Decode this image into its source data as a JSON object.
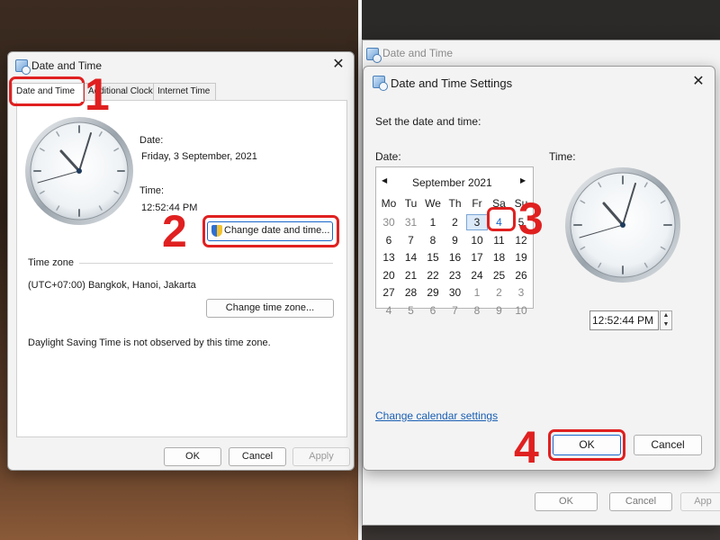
{
  "left_dialog": {
    "title": "Date and Time",
    "tabs": [
      "Date and Time",
      "Additional Clocks",
      "Internet Time"
    ],
    "date_label": "Date:",
    "date_value": "Friday, 3 September, 2021",
    "time_label": "Time:",
    "time_value": "12:52:44 PM",
    "change_datetime_button": "Change date and time...",
    "timezone_heading": "Time zone",
    "timezone_value": "(UTC+07:00) Bangkok, Hanoi, Jakarta",
    "change_timezone_button": "Change time zone...",
    "dst_note": "Daylight Saving Time is not observed by this time zone.",
    "ok": "OK",
    "cancel": "Cancel",
    "apply": "Apply"
  },
  "background_dialog": {
    "title": "Date and Time",
    "ok": "OK",
    "cancel": "Cancel",
    "apply": "App"
  },
  "settings_dialog": {
    "title": "Date and Time Settings",
    "instruction": "Set the date and time:",
    "date_label": "Date:",
    "time_label": "Time:",
    "calendar": {
      "month": "September 2021",
      "prev": "◀",
      "next": "▶",
      "weekdays": [
        "Mo",
        "Tu",
        "We",
        "Th",
        "Fr",
        "Sa",
        "Su"
      ],
      "weeks": [
        [
          "30",
          "31",
          "1",
          "2",
          "3",
          "4",
          "5"
        ],
        [
          "6",
          "7",
          "8",
          "9",
          "10",
          "11",
          "12"
        ],
        [
          "13",
          "14",
          "15",
          "16",
          "17",
          "18",
          "19"
        ],
        [
          "20",
          "21",
          "22",
          "23",
          "24",
          "25",
          "26"
        ],
        [
          "27",
          "28",
          "29",
          "30",
          "1",
          "2",
          "3"
        ],
        [
          "4",
          "5",
          "6",
          "7",
          "8",
          "9",
          "10"
        ]
      ],
      "today": "3",
      "selected": "4"
    },
    "time_value": "12:52:44 PM",
    "change_calendar_link": "Change calendar settings",
    "ok": "OK",
    "cancel": "Cancel"
  },
  "annotations": [
    "1",
    "2",
    "3",
    "4"
  ],
  "colors": {
    "highlight": "#e02020",
    "link": "#1a5fb4",
    "accent": "#1a66c9"
  }
}
